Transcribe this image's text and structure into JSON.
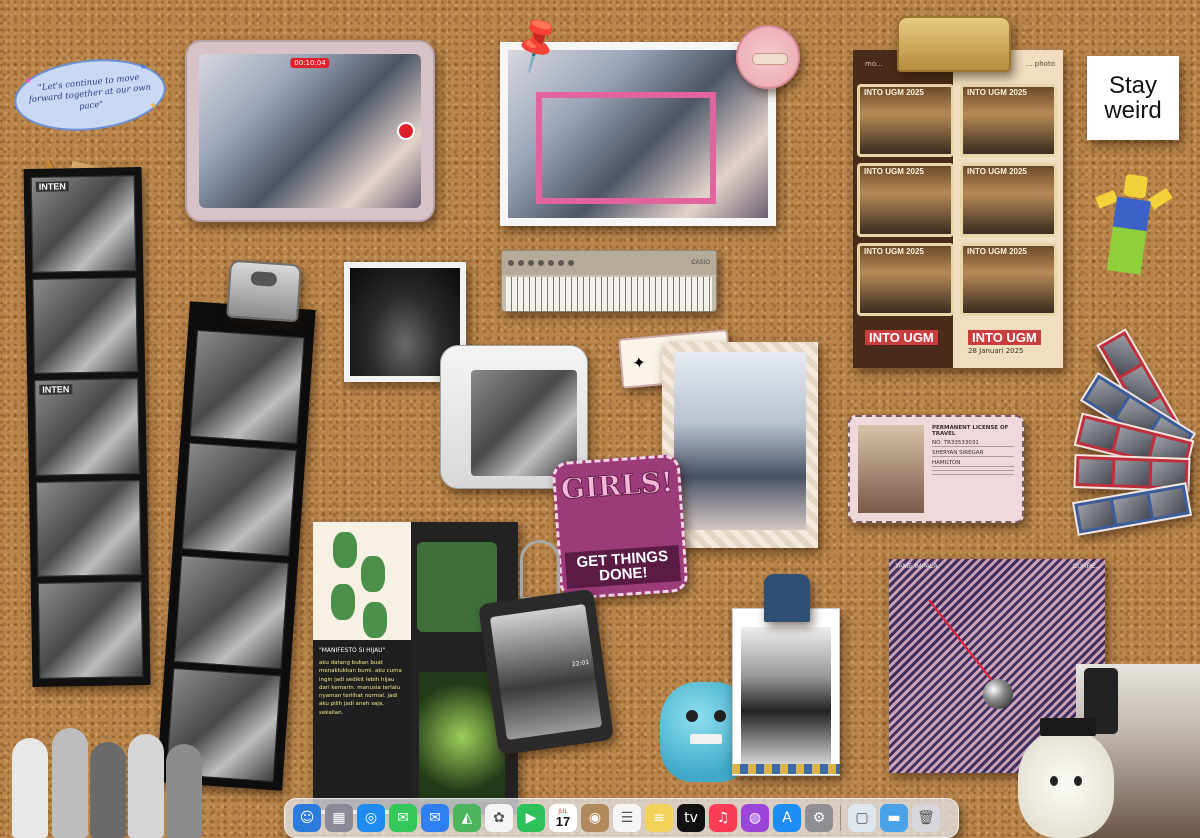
{
  "quote": {
    "text": "\"Let's continue to move forward together at our own pace\""
  },
  "ipad": {
    "rec_time": "00:10:04"
  },
  "clipboard": {
    "header": "... photo",
    "handle": "mo...",
    "booth_title": "INTO UGM 2025",
    "footer_title": "INTO UGM",
    "footer_date": "28 Januari 2025"
  },
  "stay_weird": {
    "line1": "Stay",
    "line2": "weird"
  },
  "synth": {
    "brand": "CASIO"
  },
  "left_strip": {
    "caption_1": "INTEN",
    "caption_2": "INTEN"
  },
  "license": {
    "title": "PERMANENT LICENSE OF TRAVEL",
    "no": "NO. TR33533031",
    "field_1": "SHERYAN SIREGAR",
    "field_2": "HAMILTON"
  },
  "patch": {
    "top": "GIRLS!",
    "bottom": "GET THINGS DONE!"
  },
  "zine": {
    "title": "\"MANIFESTO SI HIJAU\"",
    "body": "aku datang bukan buat menaklukkan bumi. aku cuma ingin jadi sedikit lebih hijau dari kemarin. manusia terlalu nyaman terlihat normal. jadi aku pilih jadi aneh saja, sekalian."
  },
  "card_holder": {
    "time": "22:01"
  },
  "album": {
    "artist": "TAME IMPALA",
    "title": "CURRE..."
  },
  "dock": {
    "apps": [
      {
        "name": "finder",
        "glyph": "☺",
        "color": "#2a7bdc"
      },
      {
        "name": "launchpad",
        "glyph": "▦",
        "color": "#8a8a96"
      },
      {
        "name": "safari",
        "glyph": "◎",
        "color": "#1f8bf0"
      },
      {
        "name": "messages",
        "glyph": "✉",
        "color": "#34c759"
      },
      {
        "name": "mail",
        "glyph": "✉",
        "color": "#2f7ff0"
      },
      {
        "name": "maps",
        "glyph": "◭",
        "color": "#4cb65e"
      },
      {
        "name": "photos",
        "glyph": "✿",
        "color": "#f4f4f4"
      },
      {
        "name": "facetime",
        "glyph": "▶",
        "color": "#30c25a"
      },
      {
        "name": "calendar",
        "glyph": "",
        "color": "#ffffff"
      },
      {
        "name": "contacts",
        "glyph": "◉",
        "color": "#b08a5a"
      },
      {
        "name": "reminders",
        "glyph": "☰",
        "color": "#f5f5f5"
      },
      {
        "name": "notes",
        "glyph": "≡",
        "color": "#f3d25a"
      },
      {
        "name": "tv",
        "glyph": "tv",
        "color": "#111111"
      },
      {
        "name": "music",
        "glyph": "♫",
        "color": "#fa3d55"
      },
      {
        "name": "podcasts",
        "glyph": "◍",
        "color": "#9a45d8"
      },
      {
        "name": "app-store",
        "glyph": "A",
        "color": "#1e8cf5"
      },
      {
        "name": "system-settings",
        "glyph": "⚙",
        "color": "#8e8e93"
      },
      {
        "name": "preview",
        "glyph": "▢",
        "color": "#dfe6ee"
      },
      {
        "name": "downloads-folder",
        "glyph": "▬",
        "color": "#4aa3e8"
      },
      {
        "name": "trash",
        "glyph": "🗑",
        "color": "#d8d8dc"
      }
    ],
    "calendar_month": "JUL",
    "calendar_day": "17"
  }
}
